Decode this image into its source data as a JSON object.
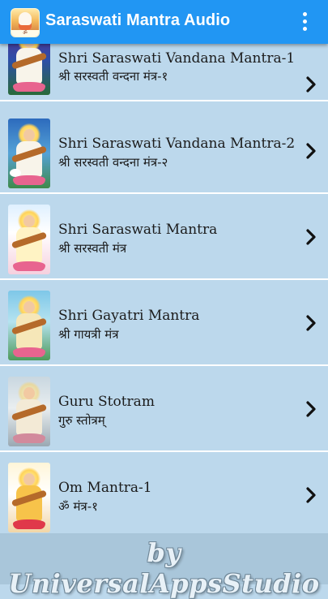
{
  "app_bar": {
    "title": "Saraswati Mantra Audio",
    "icon": "saraswati-app-icon",
    "menu_icon": "overflow-menu-icon",
    "color": "#2196f3"
  },
  "list": {
    "items": [
      {
        "title": "Shri Saraswati Vandana Mantra-1",
        "subtitle": "श्री सरस्वती वन्दना मंत्र-१",
        "thumbnail": "saraswati-image"
      },
      {
        "title": "Shri Saraswati Vandana Mantra-2",
        "subtitle": "श्री सरस्वती वन्दना मंत्र-२",
        "thumbnail": "saraswati-image"
      },
      {
        "title": "Shri Saraswati Mantra",
        "subtitle": "श्री सरस्वती मंत्र",
        "thumbnail": "saraswati-image"
      },
      {
        "title": "Shri Gayatri Mantra",
        "subtitle": "श्री गायत्री मंत्र",
        "thumbnail": "saraswati-image"
      },
      {
        "title": "Guru Stotram",
        "subtitle": "गुरु स्तोत्रम्",
        "thumbnail": "saraswati-image"
      },
      {
        "title": "Om Mantra-1",
        "subtitle": "ॐ मंत्र-१",
        "thumbnail": "saraswati-image"
      }
    ],
    "chevron_icon": "chevron-right-icon",
    "background": "#bcd8ec"
  },
  "footer": {
    "text": "by UniversalAppsStudio"
  }
}
